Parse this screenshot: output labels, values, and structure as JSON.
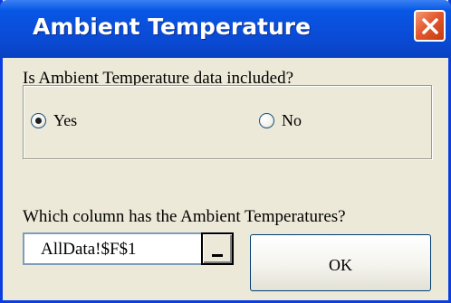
{
  "window": {
    "title": "Ambient Temperature"
  },
  "question": {
    "text": "Is Ambient Temperature data included?"
  },
  "options": {
    "yes_label": "Yes",
    "no_label": "No",
    "selected": "Yes"
  },
  "column_question": {
    "text": "Which column has the Ambient Temperatures?"
  },
  "range_input": {
    "value": "AllData!$F$1"
  },
  "buttons": {
    "ok_label": "OK"
  },
  "icons": {
    "close": "close-icon",
    "collapse": "collapse-dialog-icon"
  },
  "colors": {
    "titlebar": "#0a4fdc",
    "close_button": "#e35a2e",
    "dialog_background": "#ece9d8"
  }
}
